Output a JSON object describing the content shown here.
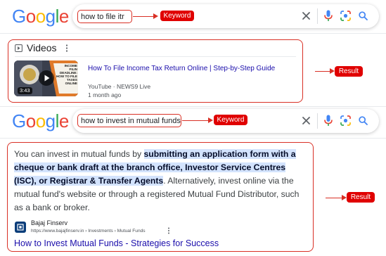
{
  "search1": {
    "query": "how to file itr",
    "tag": "Keyword"
  },
  "videos": {
    "header": "Videos",
    "title": "How To File Income Tax Return Online | Step-by-Step Guide",
    "source": "YouTube · NEWS9 Live",
    "age": "1 month ago",
    "duration": "3:43",
    "thumb_text": "INCOME\nFILIN\nDEADLINE:\nHOW TO FILE\nTAXES ONLINE",
    "result_tag": "Result"
  },
  "search2": {
    "query": "how to invest in mutual funds",
    "tag": "Keyword"
  },
  "snippet": {
    "before": "You can invest in mutual funds by ",
    "highlight": "submitting an application form with a cheque or bank draft at the branch office, Investor Service Centres (ISC), or Registrar & Transfer Agents",
    "after": ". Alternatively, invest online via the mutual fund's website or through a registered Mutual Fund Distributor, such as a bank or broker.",
    "site_name": "Bajaj Finserv",
    "site_url": "https://www.bajajfinserv.in › Investments › Mutual Funds",
    "link_title": "How to Invest Mutual Funds - Strategies for Success",
    "result_tag": "Result"
  },
  "colors": {
    "google_blue": "#4285F4",
    "google_red": "#EA4335",
    "google_yellow": "#FBBC05",
    "google_green": "#34A853",
    "annotation_red": "#d93025",
    "link_blue": "#1a0dab",
    "highlight": "#d3e3fd"
  },
  "icons": [
    "clear-icon",
    "mic-icon",
    "lens-icon",
    "search-icon",
    "video-icon",
    "more-icon",
    "play-icon",
    "site-favicon"
  ]
}
